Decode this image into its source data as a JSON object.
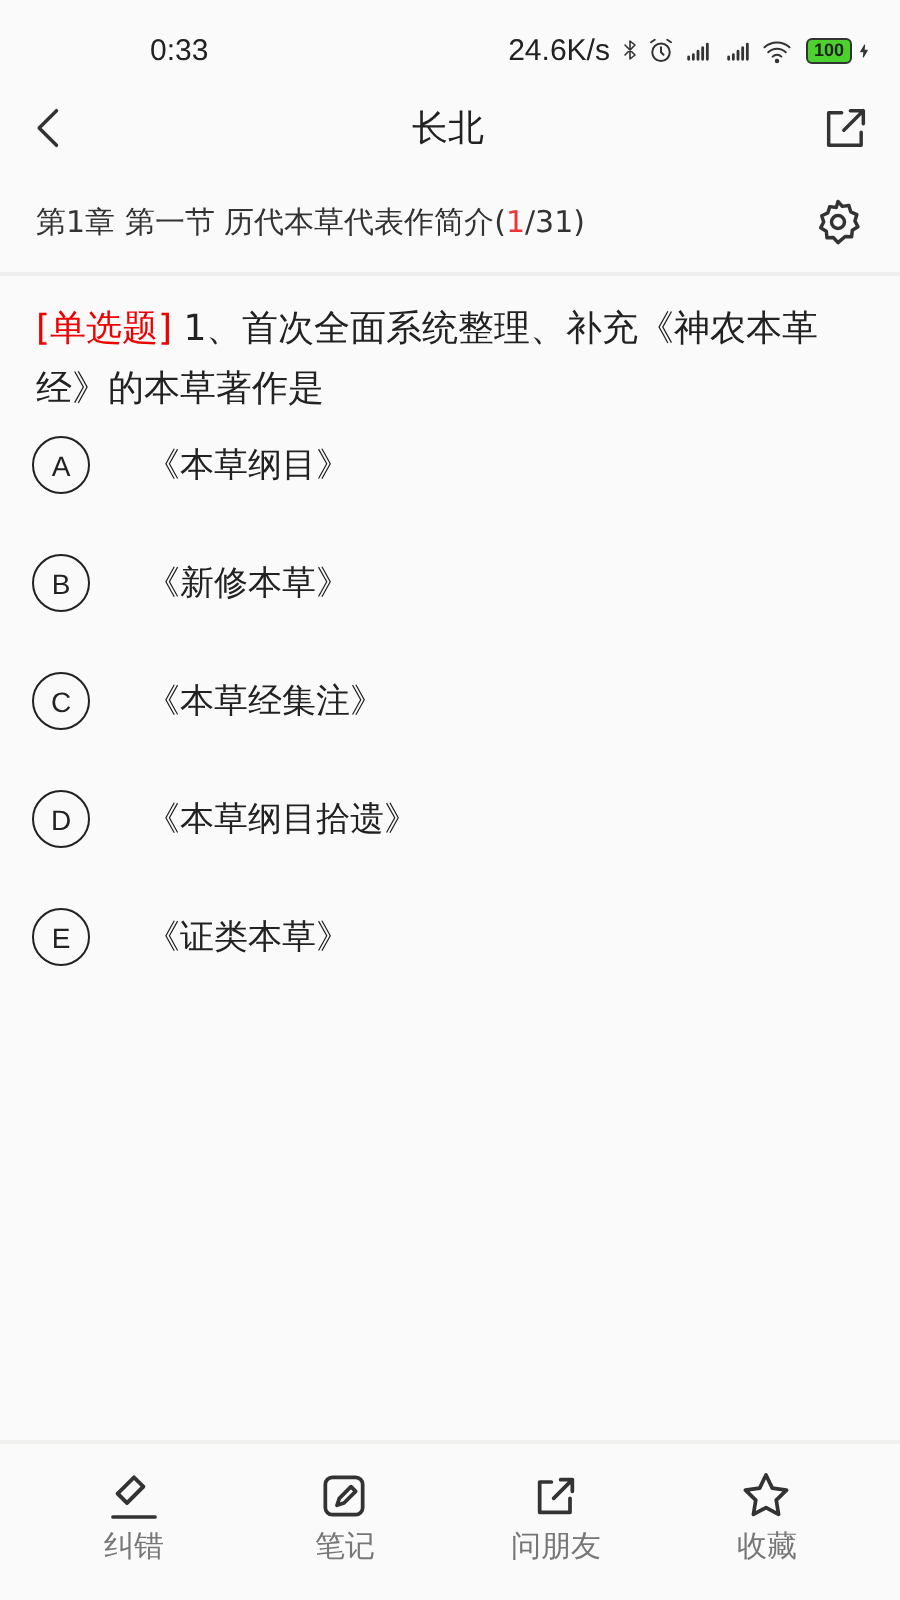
{
  "status_bar": {
    "time": "0:33",
    "speed": "24.6K/s",
    "battery": "100"
  },
  "header": {
    "title": "长北"
  },
  "progress": {
    "chapter": "第1章 第一节 历代本草代表作简介(",
    "current": "1",
    "total": "/31)"
  },
  "question": {
    "type_label": "[单选题]",
    "text": "1、首次全面系统整理、补充《神农本革经》的本草著作是"
  },
  "options": [
    {
      "letter": "A",
      "text": "《本草纲目》",
      "selected": false
    },
    {
      "letter": "B",
      "text": "《新修本草》",
      "selected": false
    },
    {
      "letter": "C",
      "text": "《本草经集注》",
      "selected": false
    },
    {
      "letter": "D",
      "text": "《本草纲目拾遗》",
      "selected": false
    },
    {
      "letter": "E",
      "text": "《证类本草》",
      "selected": false
    }
  ],
  "bottom_bar": [
    {
      "kind": "eraser",
      "label": "纠错"
    },
    {
      "kind": "note",
      "label": "笔记"
    },
    {
      "kind": "share",
      "label": "问朋友"
    },
    {
      "kind": "star",
      "label": "收藏"
    }
  ]
}
